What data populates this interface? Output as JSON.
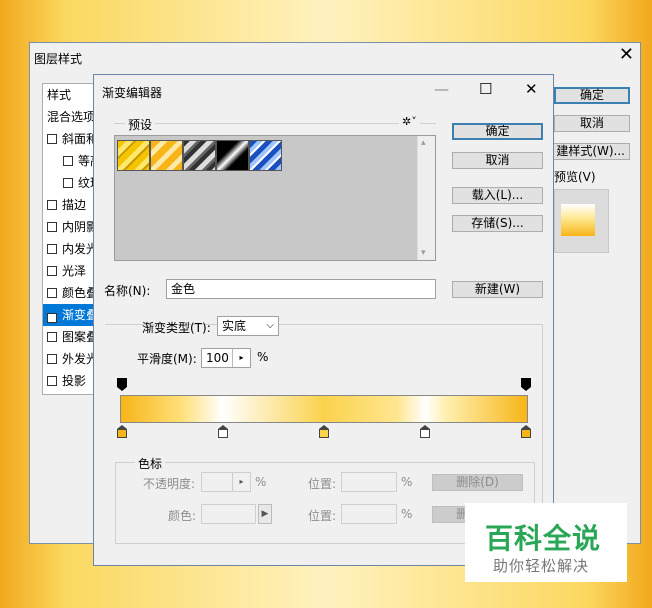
{
  "layer_style": {
    "title": "图层样式",
    "close_glyph": "✕",
    "list": [
      {
        "label": "样式",
        "checkbox": false,
        "indent": 0,
        "checked": false,
        "selected": false
      },
      {
        "label": "混合选项",
        "checkbox": false,
        "indent": 0,
        "checked": false,
        "selected": false
      },
      {
        "label": "斜面和",
        "checkbox": true,
        "indent": 0,
        "checked": false,
        "selected": false
      },
      {
        "label": "等高",
        "checkbox": true,
        "indent": 1,
        "checked": false,
        "selected": false
      },
      {
        "label": "纹理",
        "checkbox": true,
        "indent": 1,
        "checked": false,
        "selected": false
      },
      {
        "label": "描边",
        "checkbox": true,
        "indent": 0,
        "checked": false,
        "selected": false
      },
      {
        "label": "内阴影",
        "checkbox": true,
        "indent": 0,
        "checked": false,
        "selected": false
      },
      {
        "label": "内发光",
        "checkbox": true,
        "indent": 0,
        "checked": false,
        "selected": false
      },
      {
        "label": "光泽",
        "checkbox": true,
        "indent": 0,
        "checked": false,
        "selected": false
      },
      {
        "label": "颜色叠",
        "checkbox": true,
        "indent": 0,
        "checked": false,
        "selected": false
      },
      {
        "label": "渐变叠",
        "checkbox": true,
        "indent": 0,
        "checked": true,
        "selected": true
      },
      {
        "label": "图案叠",
        "checkbox": true,
        "indent": 0,
        "checked": false,
        "selected": false
      },
      {
        "label": "外发光",
        "checkbox": true,
        "indent": 0,
        "checked": false,
        "selected": false
      },
      {
        "label": "投影",
        "checkbox": true,
        "indent": 0,
        "checked": false,
        "selected": false
      }
    ],
    "ok_label": "确定",
    "cancel_label": "取消",
    "new_style_label": "建样式(W)...",
    "preview_label": "预览(V)"
  },
  "gradient_editor": {
    "title": "渐变编辑器",
    "minimize_glyph": "—",
    "maximize_glyph": "☐",
    "close_glyph": "✕",
    "presets_label": "预设",
    "gear_glyph": "✲˅",
    "ok_label": "确定",
    "cancel_label": "取消",
    "load_label": "载入(L)...",
    "save_label": "存储(S)...",
    "name_label": "名称(N):",
    "name_value": "金色",
    "new_label": "新建(W)",
    "gradient_type_label": "渐变类型(T):",
    "gradient_type_value": "实底",
    "smoothness_label": "平滑度(M):",
    "smoothness_value": "100",
    "smoothness_unit": "%",
    "color_stops_label": "色标",
    "opacity_label": "不透明度:",
    "opacity_unit": "%",
    "position_label_1": "位置:",
    "position_unit_1": "%",
    "delete_label_1": "删除(D)",
    "color_label": "颜色:",
    "position_label_2": "位置:",
    "position_unit_2": "%",
    "delete_label_2": "删除(D)"
  },
  "colors": {
    "accent": "#0078d7",
    "gold": "#f7b518",
    "light_gold": "#ffe07a"
  },
  "watermark": {
    "line1": "百科全说",
    "line2": "助你轻松解决"
  }
}
